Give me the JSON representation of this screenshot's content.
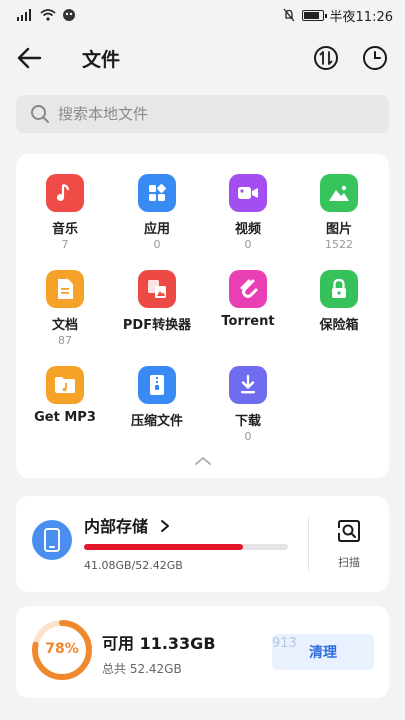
{
  "status": {
    "time": "半夜11:26"
  },
  "header": {
    "title": "文件"
  },
  "search": {
    "placeholder": "搜索本地文件"
  },
  "categories": [
    {
      "label": "音乐",
      "count": "7",
      "color": "#ef4b47"
    },
    {
      "label": "应用",
      "count": "0",
      "color": "#3a8af4"
    },
    {
      "label": "视频",
      "count": "0",
      "color": "#a34ef0"
    },
    {
      "label": "图片",
      "count": "1522",
      "color": "#37c45c"
    },
    {
      "label": "文档",
      "count": "87",
      "color": "#f6a128"
    },
    {
      "label": "PDF转换器",
      "count": "",
      "color": "#ee4a45"
    },
    {
      "label": "Torrent",
      "count": "",
      "color": "#e83fb5"
    },
    {
      "label": "保险箱",
      "count": "",
      "color": "#36c25a"
    },
    {
      "label": "Get MP3",
      "count": "",
      "color": "#f6a128"
    },
    {
      "label": "压缩文件",
      "count": "",
      "color": "#3a8af4"
    },
    {
      "label": "下载",
      "count": "0",
      "color": "#6f6cf0"
    }
  ],
  "storage": {
    "title": "内部存储",
    "size_text": "41.08GB/52.42GB",
    "used_fraction": 0.78,
    "scan_label": "扫描",
    "bar_color": "#e4152b"
  },
  "available": {
    "percent_text": "78%",
    "percent": 78,
    "title": "可用 11.33GB",
    "total": "总共 52.42GB",
    "clean_label": "清理",
    "watermark": "913"
  }
}
